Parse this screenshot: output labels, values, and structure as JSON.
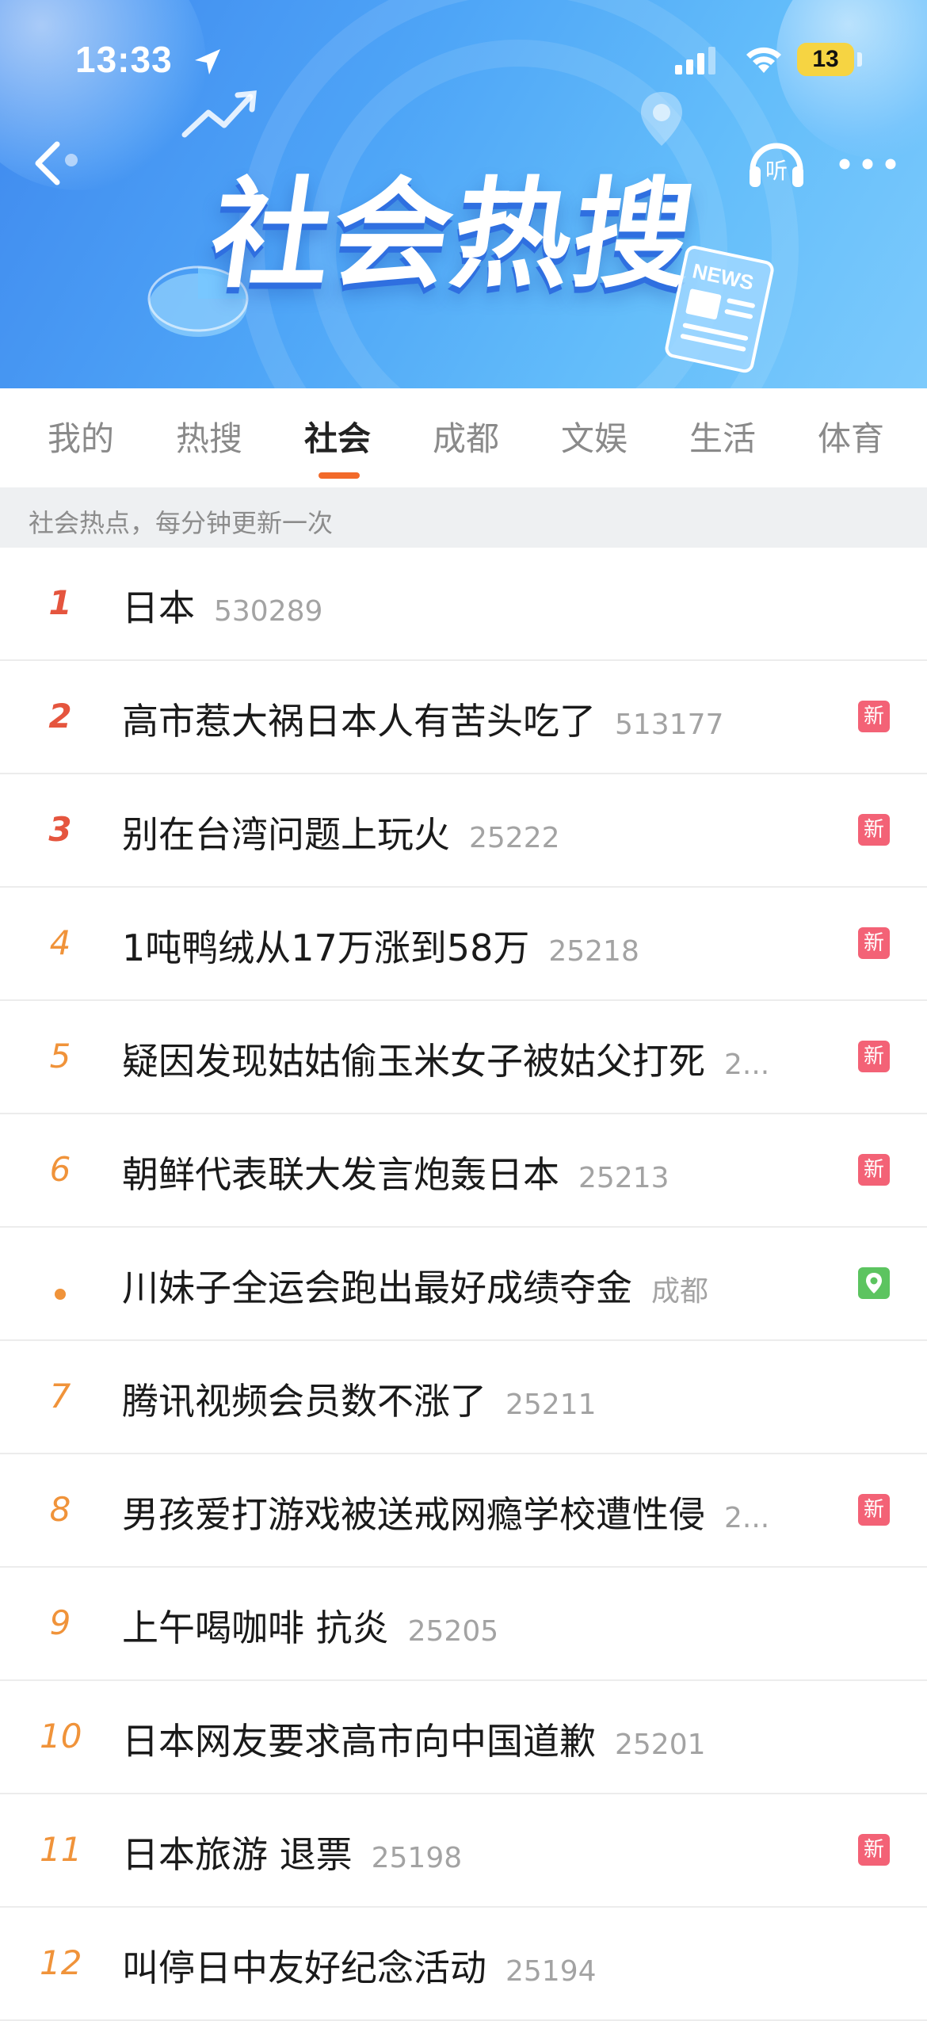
{
  "status": {
    "time": "13:33",
    "battery": "13"
  },
  "banner": {
    "title": "社会热搜",
    "listen_label": "听",
    "news_label": "NEWS"
  },
  "tabs": [
    {
      "label": "我的"
    },
    {
      "label": "热搜"
    },
    {
      "label": "社会",
      "active": true
    },
    {
      "label": "成都"
    },
    {
      "label": "文娱"
    },
    {
      "label": "生活"
    },
    {
      "label": "体育"
    }
  ],
  "subheader": "社会热点，每分钟更新一次",
  "list": [
    {
      "rank": "1",
      "title": "日本",
      "count": "530289",
      "badge": ""
    },
    {
      "rank": "2",
      "title": "高市惹大祸日本人有苦头吃了",
      "count": "513177",
      "badge": "新"
    },
    {
      "rank": "3",
      "title": "别在台湾问题上玩火",
      "count": "25222",
      "badge": "新"
    },
    {
      "rank": "4",
      "title": "1吨鸭绒从17万涨到58万",
      "count": "25218",
      "badge": "新"
    },
    {
      "rank": "5",
      "title": "疑因发现姑姑偷玉米女子被姑父打死",
      "count": "2...",
      "badge": "新"
    },
    {
      "rank": "6",
      "title": "朝鲜代表联大发言炮轰日本",
      "count": "25213",
      "badge": "新"
    },
    {
      "rank": "",
      "title": "川妹子全运会跑出最好成绩夺金",
      "count": "成都",
      "badge": "location"
    },
    {
      "rank": "7",
      "title": "腾讯视频会员数不涨了",
      "count": "25211",
      "badge": ""
    },
    {
      "rank": "8",
      "title": "男孩爱打游戏被送戒网瘾学校遭性侵",
      "count": "2...",
      "badge": "新"
    },
    {
      "rank": "9",
      "title": "上午喝咖啡 抗炎",
      "count": "25205",
      "badge": ""
    },
    {
      "rank": "10",
      "title": "日本网友要求高市向中国道歉",
      "count": "25201",
      "badge": ""
    },
    {
      "rank": "11",
      "title": "日本旅游 退票",
      "count": "25198",
      "badge": "新"
    },
    {
      "rank": "12",
      "title": "叫停日中友好纪念活动",
      "count": "25194",
      "badge": ""
    }
  ],
  "colors": {
    "accent": "#f26a2a",
    "new_badge": "#f36276",
    "location_badge": "#5cc460",
    "top_rank": "#e5553e",
    "rank": "#f0933a"
  }
}
